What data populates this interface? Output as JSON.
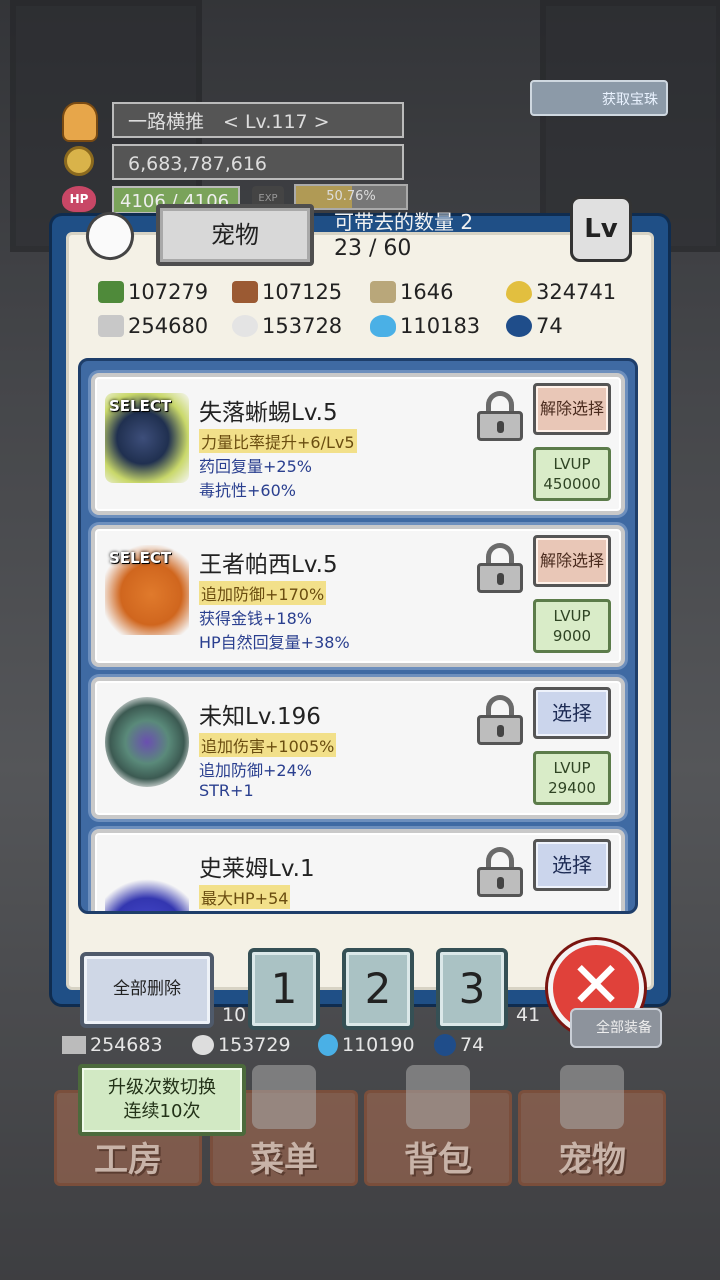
{
  "player": {
    "name_level": "一路横推　< Lv.117 >",
    "gold": "6,683,787,616",
    "hp_icon": "HP",
    "hp": "4106 / 4106",
    "exp_icon": "EXP",
    "exp_percent": "50.76%",
    "exp_fraction": 0.5076
  },
  "top_button": {
    "label": "获取宝珠"
  },
  "panel": {
    "title": "宠物",
    "carry_label": "可带去的数量 2",
    "carry_count": "23 / 60",
    "lv_button": "Lv"
  },
  "resources": [
    {
      "icon": "herb-icon",
      "value": "107279"
    },
    {
      "icon": "wood-log-icon",
      "value": "107125"
    },
    {
      "icon": "plank-icon",
      "value": "1646"
    },
    {
      "icon": "gold-drop-icon",
      "value": "324741"
    },
    {
      "icon": "iron-bar-icon",
      "value": "254680"
    },
    {
      "icon": "stone-icon",
      "value": "153728"
    },
    {
      "icon": "blue-flame-icon",
      "value": "110183"
    },
    {
      "icon": "orb-icon",
      "value": "74"
    }
  ],
  "pets": [
    {
      "name": "失落蜥蜴Lv.5",
      "selected": true,
      "select_tag": "SELECT",
      "stats": [
        "力量比率提升+6/Lv5",
        "药回复量+25%",
        "毒抗性+60%"
      ],
      "action": "解除选择",
      "lvup_label": "LVUP",
      "lvup_cost": "450000"
    },
    {
      "name": "王者帕西Lv.5",
      "selected": true,
      "select_tag": "SELECT",
      "stats": [
        "追加防御+170%",
        "获得金钱+18%",
        "HP自然回复量+38%"
      ],
      "action": "解除选择",
      "lvup_label": "LVUP",
      "lvup_cost": "9000"
    },
    {
      "name": "未知Lv.196",
      "selected": false,
      "stats": [
        "追加伤害+1005%",
        "追加防御+24%",
        "STR+1"
      ],
      "action": "选择",
      "lvup_label": "LVUP",
      "lvup_cost": "29400"
    },
    {
      "name": "史莱姆Lv.1",
      "selected": false,
      "stats": [
        "最大HP+54"
      ],
      "action": "选择"
    }
  ],
  "controls": {
    "clear_all": "全部删除",
    "slots": [
      "1",
      "2",
      "3"
    ],
    "close": "✕"
  },
  "bottom_resources": [
    "254683",
    "153729",
    "110190",
    "74"
  ],
  "bottom_partial": {
    "left": "10",
    "right": "41"
  },
  "equip_button": "全部装备",
  "upgrade_toggle": {
    "line1": "升级次数切换",
    "line2": "连续10次"
  },
  "nav": [
    "工房",
    "菜单",
    "背包",
    "宠物"
  ]
}
